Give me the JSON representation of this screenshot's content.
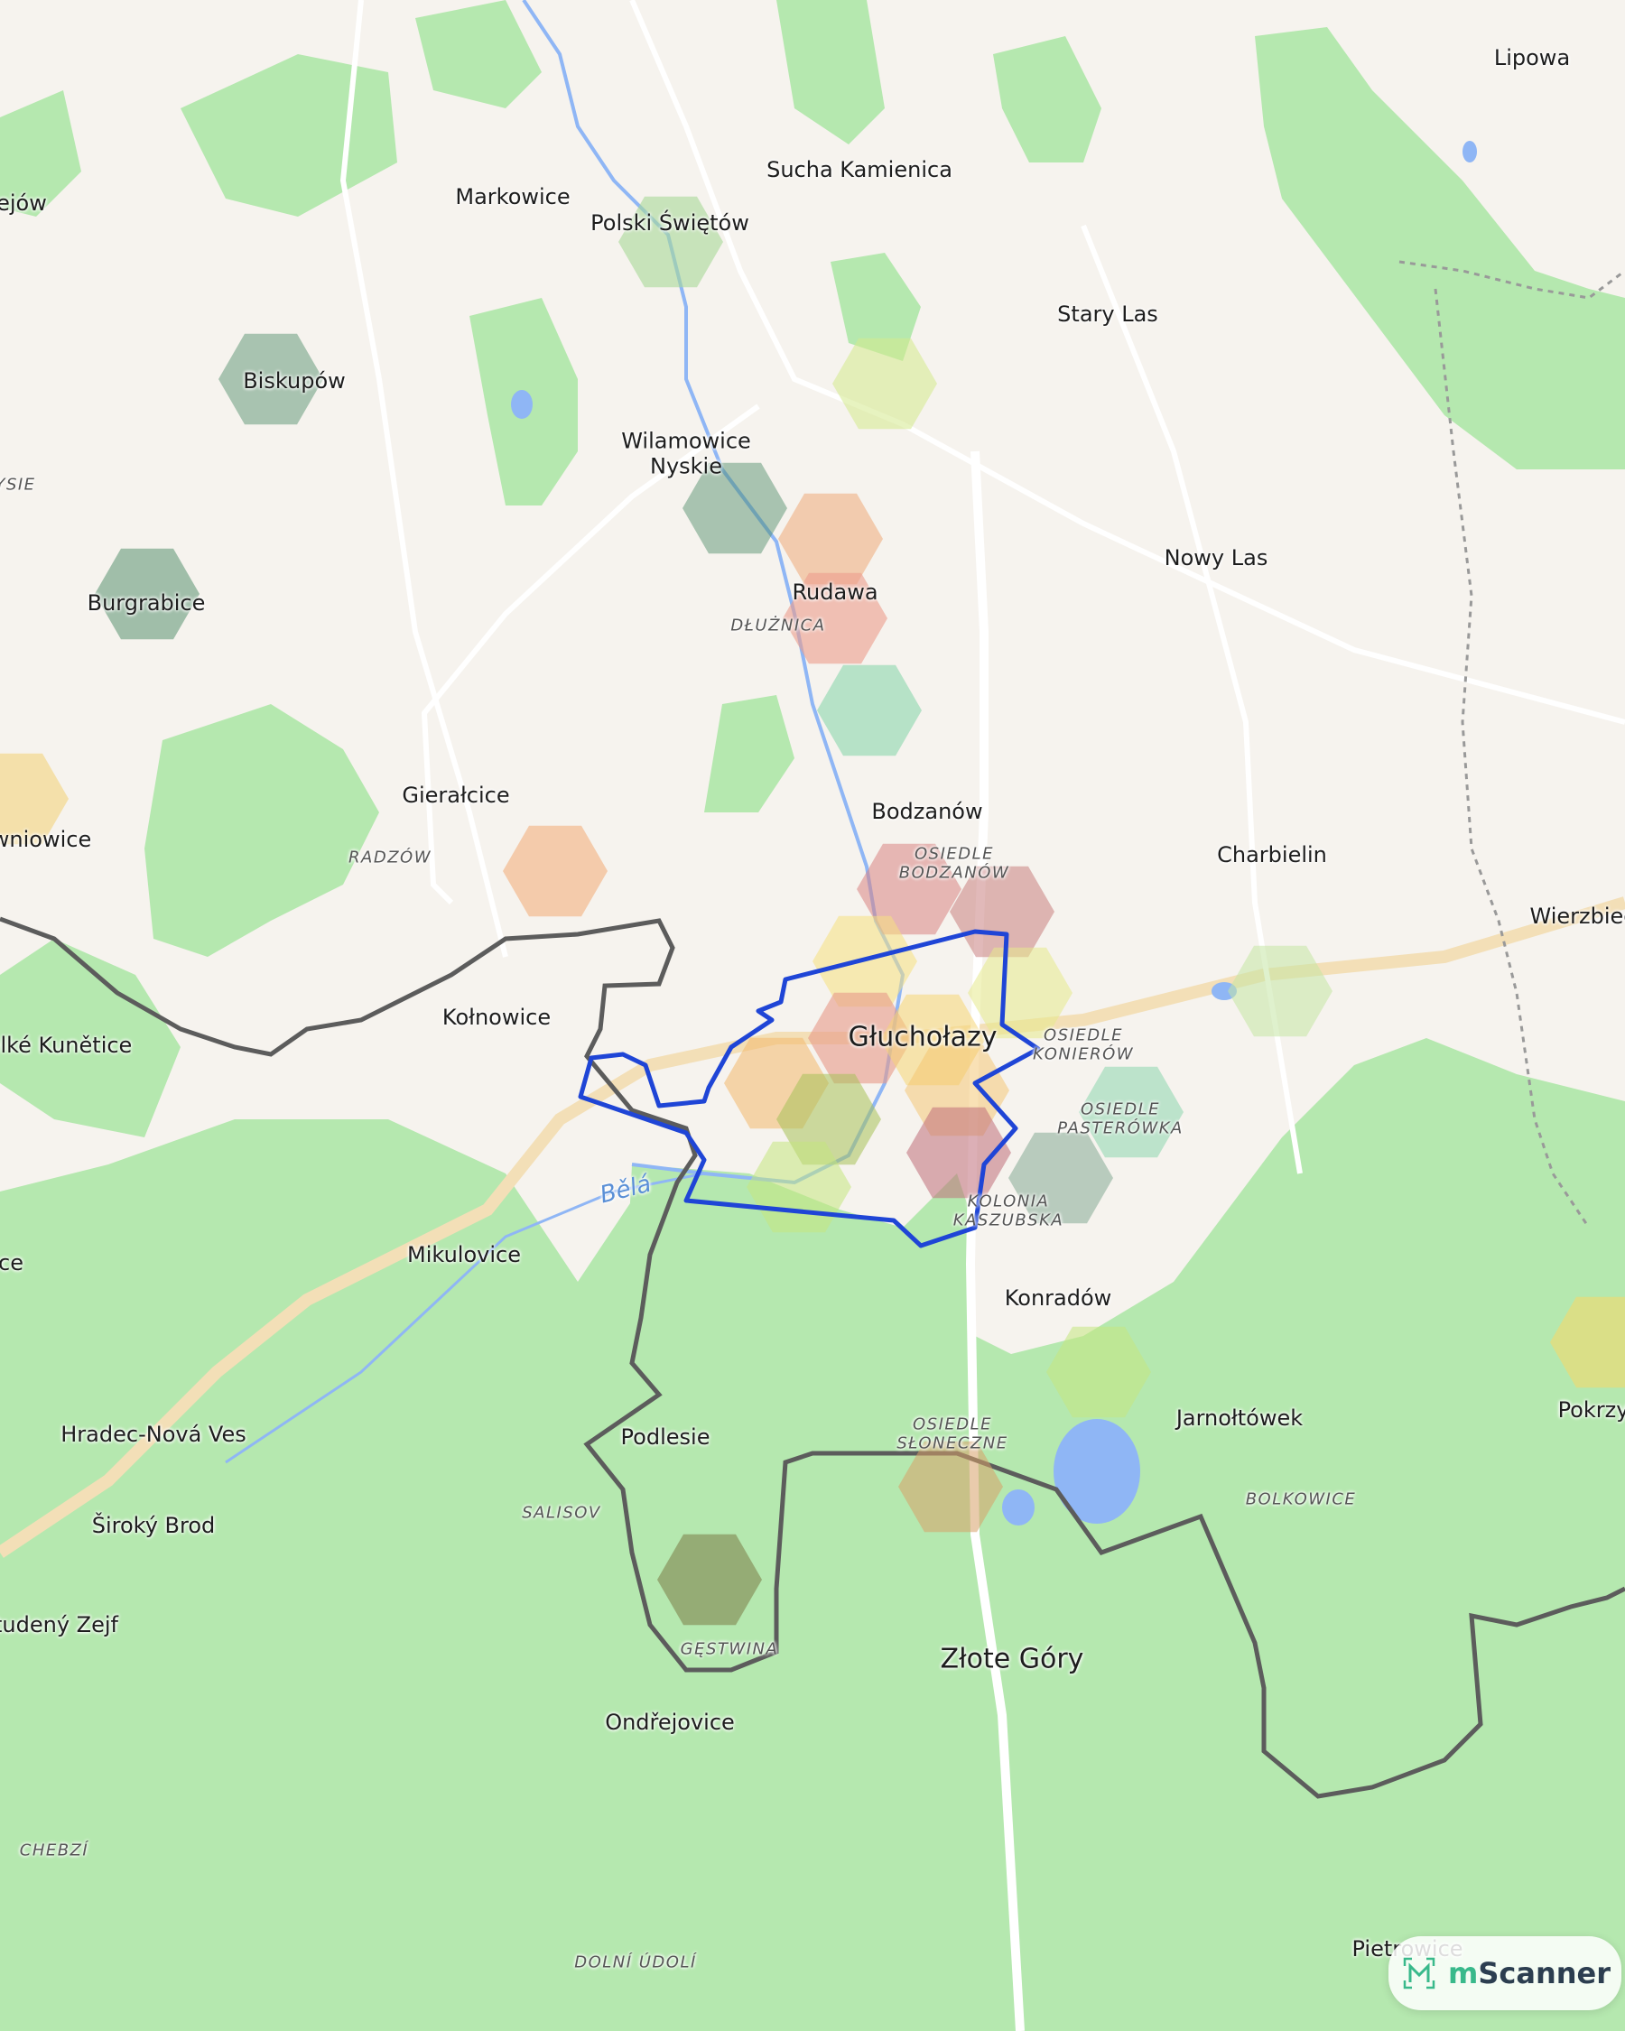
{
  "map": {
    "labels": [
      {
        "id": "lipowa",
        "text": "Lipowa",
        "type": "place"
      },
      {
        "id": "sucha-kamienica",
        "text": "Sucha Kamienica",
        "type": "place"
      },
      {
        "id": "markowice",
        "text": "Markowice",
        "type": "place"
      },
      {
        "id": "polski-swietow",
        "text": "Polski Świętów",
        "type": "place"
      },
      {
        "id": "stary-las",
        "text": "Stary Las",
        "type": "place"
      },
      {
        "id": "biskupow",
        "text": "Biskupów",
        "type": "place"
      },
      {
        "id": "wilamowice-nyskie",
        "text": "Wilamowice\nNyskie",
        "type": "place"
      },
      {
        "id": "nowy-las",
        "text": "Nowy Las",
        "type": "place"
      },
      {
        "id": "burgrabice",
        "text": "Burgrabice",
        "type": "place"
      },
      {
        "id": "rudawa",
        "text": "Rudawa",
        "type": "place"
      },
      {
        "id": "dluznica",
        "text": "DŁUŻNICA",
        "type": "district"
      },
      {
        "id": "gieralcice",
        "text": "Gierałcice",
        "type": "place"
      },
      {
        "id": "bodzanow",
        "text": "Bodzanów",
        "type": "place"
      },
      {
        "id": "charbielin",
        "text": "Charbielin",
        "type": "place"
      },
      {
        "id": "radzow",
        "text": "RADZÓW",
        "type": "district"
      },
      {
        "id": "osiedle-bodzanow",
        "text": "OSIEDLE\nBODZANÓW",
        "type": "district"
      },
      {
        "id": "wierzbiec",
        "text": "Wierzbiec",
        "type": "place"
      },
      {
        "id": "kolnowice",
        "text": "Kołnowice",
        "type": "place"
      },
      {
        "id": "glucholazy",
        "text": "Głuchołazy",
        "type": "city"
      },
      {
        "id": "osiedle-konierow",
        "text": "OSIEDLE\nKONIERÓW",
        "type": "district"
      },
      {
        "id": "velke-kunetice",
        "text": "elké Kunětice",
        "type": "place"
      },
      {
        "id": "osiedle-pasterowka",
        "text": "OSIEDLE\nPASTERÓWKA",
        "type": "district"
      },
      {
        "id": "bela",
        "text": "Bělá",
        "type": "river"
      },
      {
        "id": "kolonia-kaszubska",
        "text": "KOLONIA\nKASZUBSKA",
        "type": "district"
      },
      {
        "id": "mikulovice",
        "text": "Mikulovice",
        "type": "place"
      },
      {
        "id": "konradow",
        "text": "Konradów",
        "type": "place"
      },
      {
        "id": "osiedle-sloneczne",
        "text": "OSIEDLE\nSŁONECZNE",
        "type": "district"
      },
      {
        "id": "jarnoltowek",
        "text": "Jarnołtówek",
        "type": "place"
      },
      {
        "id": "hradec-nova-ves",
        "text": "Hradec-Nová Ves",
        "type": "place"
      },
      {
        "id": "podlesie",
        "text": "Podlesie",
        "type": "place"
      },
      {
        "id": "pokrzywna",
        "text": "Pokrzy",
        "type": "place"
      },
      {
        "id": "salisov",
        "text": "SALISOV",
        "type": "district"
      },
      {
        "id": "bolkowice",
        "text": "BOLKOWICE",
        "type": "district"
      },
      {
        "id": "siroky-brod",
        "text": "Široký Brod",
        "type": "place"
      },
      {
        "id": "studeny-zejf",
        "text": "tudený Zejf",
        "type": "place"
      },
      {
        "id": "gestwina",
        "text": "GĘSTWINA",
        "type": "district"
      },
      {
        "id": "zlote-gory",
        "text": "Złote Góry",
        "type": "city"
      },
      {
        "id": "ondrejovice",
        "text": "Ondřejovice",
        "type": "place"
      },
      {
        "id": "chebzi",
        "text": "CHEBZÍ",
        "type": "district"
      },
      {
        "id": "dolni-udoli",
        "text": "DOLNÍ ÚDOLÍ",
        "type": "district"
      },
      {
        "id": "pietrowice",
        "text": "Pietrowice",
        "type": "place"
      },
      {
        "id": "lejow",
        "text": "ejów",
        "type": "place"
      },
      {
        "id": "ysie",
        "text": "YSIE",
        "type": "district"
      },
      {
        "id": "wniowice",
        "text": "wniowice",
        "type": "place"
      },
      {
        "id": "ce",
        "text": "ce",
        "type": "place"
      }
    ],
    "colors": {
      "land": "#f6f3ee",
      "forest": "#b5e8af",
      "forest_light": "#c8ecc0",
      "water": "#8fb6f5",
      "boundary_outline": "#1f45d6",
      "country_border": "#5c5c5c",
      "road": "#ffffff",
      "main_road": "#f3dfb7"
    }
  },
  "brand": {
    "prefix": "m",
    "name": "Scanner",
    "icon": "mscanner-logo-icon"
  }
}
